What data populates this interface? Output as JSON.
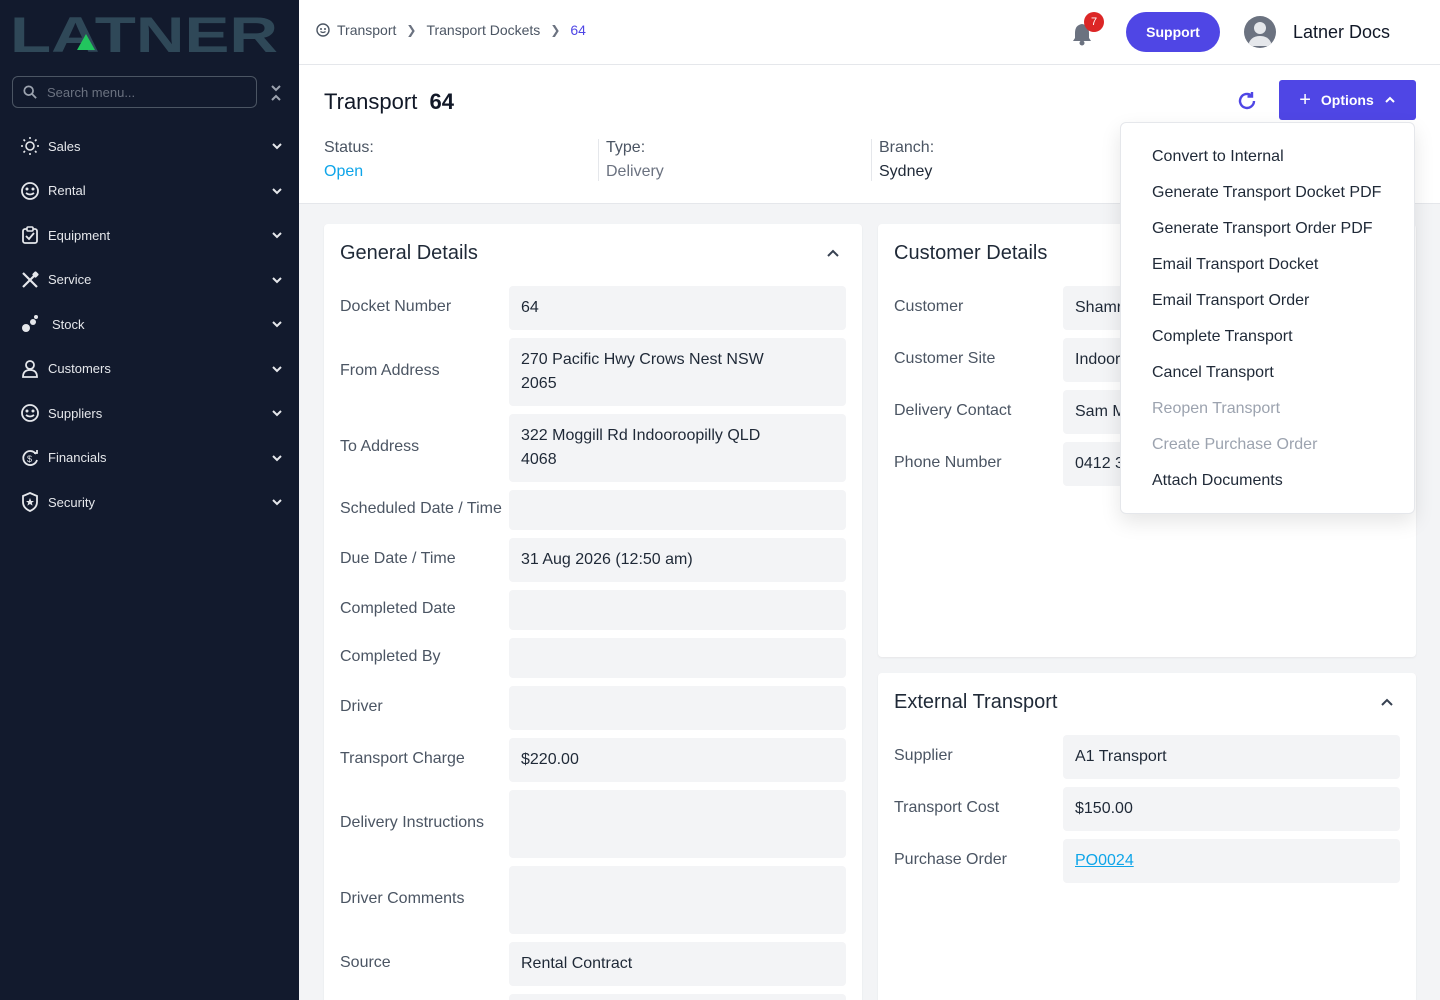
{
  "brand": {
    "logo_text": "LATNER"
  },
  "sidebar": {
    "search_placeholder": "Search menu...",
    "items": [
      {
        "label": "Sales",
        "icon": "sales-icon"
      },
      {
        "label": "Rental",
        "icon": "rental-icon"
      },
      {
        "label": "Equipment",
        "icon": "equipment-icon"
      },
      {
        "label": "Service",
        "icon": "service-icon"
      },
      {
        "label": "Stock",
        "icon": "stock-icon"
      },
      {
        "label": "Customers",
        "icon": "customers-icon"
      },
      {
        "label": "Suppliers",
        "icon": "suppliers-icon"
      },
      {
        "label": "Financials",
        "icon": "financials-icon"
      },
      {
        "label": "Security",
        "icon": "security-icon"
      }
    ]
  },
  "topbar": {
    "breadcrumb": [
      "Transport",
      "Transport Dockets",
      "64"
    ],
    "notification_count": "7",
    "support_label": "Support",
    "user_name": "Latner Docs"
  },
  "header": {
    "title": "Transport",
    "number": "64",
    "options_label": "Options",
    "status_label": "Status:",
    "status_value": "Open",
    "type_label": "Type:",
    "type_value": "Delivery",
    "branch_label": "Branch:",
    "branch_value": "Sydney"
  },
  "general": {
    "title": "General Details",
    "fields": [
      {
        "label": "Docket Number",
        "value": "64"
      },
      {
        "label": "From Address",
        "value": "270 Pacific Hwy Crows Nest NSW 2065"
      },
      {
        "label": "To Address",
        "value": "322 Moggill Rd Indooroopilly QLD 4068"
      },
      {
        "label": "Scheduled Date / Time",
        "value": ""
      },
      {
        "label": "Due Date / Time",
        "value": "31 Aug 2026 (12:50 am)"
      },
      {
        "label": "Completed Date",
        "value": ""
      },
      {
        "label": "Completed By",
        "value": ""
      },
      {
        "label": "Driver",
        "value": ""
      },
      {
        "label": "Transport Charge",
        "value": "$220.00"
      },
      {
        "label": "Delivery Instructions",
        "value": ""
      },
      {
        "label": "Driver Comments",
        "value": ""
      },
      {
        "label": "Source",
        "value": "Rental Contract"
      }
    ]
  },
  "customer": {
    "title": "Customer Details",
    "fields": [
      {
        "label": "Customer",
        "value": "Shamr"
      },
      {
        "label": "Customer Site",
        "value": "Indoor"
      },
      {
        "label": "Delivery Contact",
        "value": "Sam M"
      },
      {
        "label": "Phone Number",
        "value": "0412 3"
      }
    ]
  },
  "external": {
    "title": "External Transport",
    "fields": [
      {
        "label": "Supplier",
        "value": "A1 Transport"
      },
      {
        "label": "Transport Cost",
        "value": "$150.00"
      },
      {
        "label": "Purchase Order",
        "value": "PO0024"
      }
    ]
  },
  "options_menu": [
    {
      "label": "Convert to Internal",
      "enabled": true
    },
    {
      "label": "Generate Transport Docket PDF",
      "enabled": true
    },
    {
      "label": "Generate Transport Order PDF",
      "enabled": true
    },
    {
      "label": "Email Transport Docket",
      "enabled": true
    },
    {
      "label": "Email Transport Order",
      "enabled": true
    },
    {
      "label": "Complete Transport",
      "enabled": true
    },
    {
      "label": "Cancel Transport",
      "enabled": true
    },
    {
      "label": "Reopen Transport",
      "enabled": false
    },
    {
      "label": "Create Purchase Order",
      "enabled": false
    },
    {
      "label": "Attach Documents",
      "enabled": true
    }
  ],
  "colors": {
    "sidebar_bg": "#121a2d",
    "accent": "#4f46e5",
    "logo": "#2f4858",
    "logo_accent": "#22c55e",
    "status_open": "#0ea5e9",
    "badge": "#dc2626"
  }
}
